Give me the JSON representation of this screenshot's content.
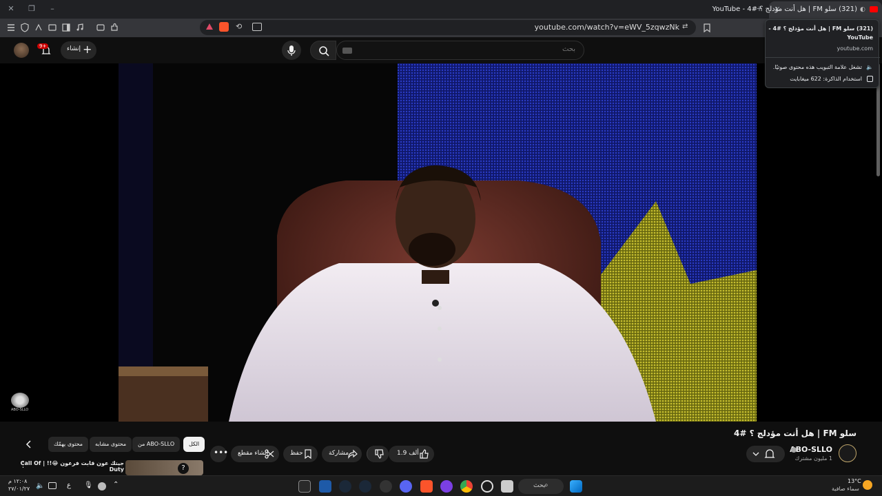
{
  "browser": {
    "tab_title": "(321) سلو FM | هل أنت مؤدلج ؟ #4 - YouTube",
    "url": "youtube.com/watch?v=eWV_5zqwzNk",
    "shield_count": "",
    "hovercard": {
      "title_line1": "(321) سلو FM | هل أنت مؤدلج ؟ #4 -",
      "title_line2": "YouTube",
      "domain": "youtube.com",
      "audio_note": "تشغل علامة التبويب هذه محتوى صوتيًا.",
      "memory_note": "استخدام الذاكرة: 622 ميغابايت"
    }
  },
  "youtube": {
    "search_placeholder": "بحث",
    "create_label": "إنشاء",
    "notifications_badge": "9+",
    "video_title": "سلو FM | هل أنت مؤدلج ؟ #4",
    "watermark": "ABO-SLLO",
    "channel": {
      "name": "ABO-SLLO",
      "subscribers": "1 مليون مشترك"
    },
    "actions": {
      "likes": "1.9 ألف",
      "share": "مشاركة",
      "save": "حفظ",
      "clip": "إنشاء مقطع"
    },
    "chips": [
      "الكل",
      "من ABO-SLLO",
      "محتوى مشابه",
      "محتوى يهمّك"
    ],
    "recommended": {
      "title_line1": "جيتك عون قابت فرعون 😂!! | Call Of",
      "title_line2": "Duty"
    }
  },
  "taskbar": {
    "search_label": "بحث",
    "temperature": "13°C",
    "weather": "سماء صافية",
    "time": "١٢:٠٨ م",
    "date": "٢٧/٠١/٢٧",
    "language": "ع"
  },
  "colors": {
    "youtube_bg": "#0f0f0f",
    "accent_red": "#cc0000",
    "chair": "#5a2a22",
    "shirt": "#e8e0e8",
    "backdrop_blue": "#1a2a8c",
    "backdrop_yellow": "#b8b020"
  }
}
